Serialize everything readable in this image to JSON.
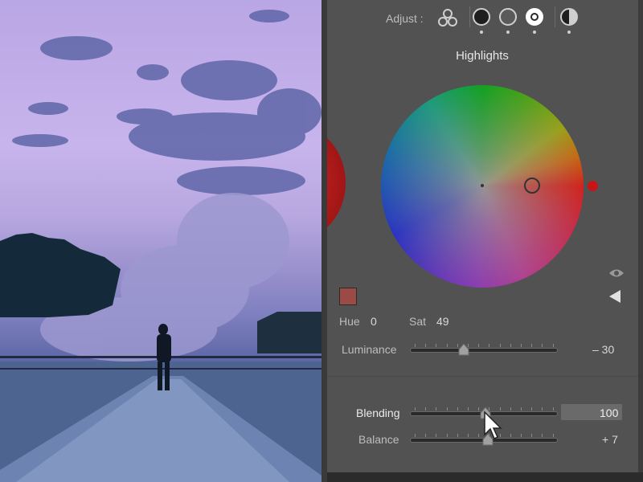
{
  "adjust": {
    "label": "Adjust :",
    "modes": [
      {
        "name": "three-way",
        "active": false
      },
      {
        "name": "shadows",
        "active": false
      },
      {
        "name": "midtones",
        "active": false
      },
      {
        "name": "highlights",
        "active": true
      },
      {
        "name": "global",
        "active": false
      }
    ]
  },
  "wheel": {
    "title": "Highlights",
    "hue_label": "Hue",
    "hue_value": "0",
    "sat_label": "Sat",
    "sat_value": "49",
    "swatch_color": "#9b4a45"
  },
  "sliders": {
    "luminance": {
      "label": "Luminance",
      "value": "– 30",
      "fraction": 0.37
    },
    "blending": {
      "label": "Blending",
      "value": "100",
      "fraction": 0.52
    },
    "balance": {
      "label": "Balance",
      "value": "+ 7",
      "fraction": 0.53
    }
  },
  "colors": {
    "panel": "#525252",
    "accent_red": "#c81414"
  }
}
